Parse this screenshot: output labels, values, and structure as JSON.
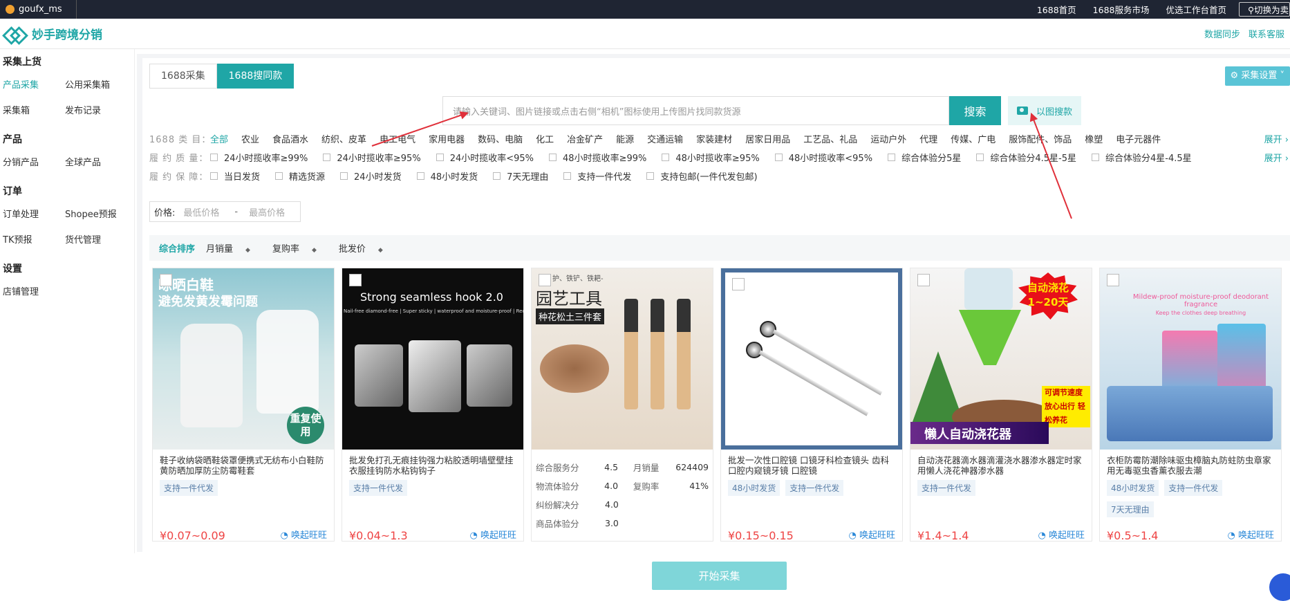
{
  "topbar": {
    "username": "goufx_ms",
    "links": [
      "1688首页",
      "1688服务市场",
      "优选工作台首页"
    ],
    "switch_label": "切换为卖家"
  },
  "header": {
    "brand": "妙手跨境分销",
    "right_links": [
      "数据同步",
      "联系客服"
    ]
  },
  "sidebar": {
    "groups": [
      {
        "title": "采集上货",
        "items": [
          "产品采集",
          "公用采集箱",
          "采集箱",
          "发布记录"
        ]
      },
      {
        "title": "产品",
        "items": [
          "分销产品",
          "全球产品"
        ]
      },
      {
        "title": "订单",
        "items": [
          "订单处理",
          "Shopee预报",
          "TK预报",
          "货代管理"
        ]
      },
      {
        "title": "设置",
        "items": [
          "店铺管理"
        ]
      }
    ],
    "active_item": "产品采集"
  },
  "tabs": [
    {
      "label": "1688采集",
      "active": false
    },
    {
      "label": "1688搜同款",
      "active": true
    }
  ],
  "collect_settings_label": "采集设置",
  "search": {
    "placeholder": "请输入关键词、图片链接或点击右侧“相机”图标使用上传图片找同款货源",
    "button_label": "搜索",
    "image_search_label": "以图搜款"
  },
  "filters": {
    "category": {
      "label": "1688 类 目：",
      "options": [
        "全部",
        "农业",
        "食品酒水",
        "纺织、皮革",
        "电工电气",
        "家用电器",
        "数码、电脑",
        "化工",
        "冶金矿产",
        "能源",
        "交通运输",
        "家装建材",
        "居家日用品",
        "工艺品、礼品",
        "运动户外",
        "代理",
        "传媒、广电",
        "服饰配件、饰品",
        "橡塑",
        "电子元器件"
      ],
      "expand": "展开"
    },
    "quality": {
      "label": "履 约 质 量：",
      "options": [
        "24小时揽收率≥99%",
        "24小时揽收率≥95%",
        "24小时揽收率<95%",
        "48小时揽收率≥99%",
        "48小时揽收率≥95%",
        "48小时揽收率<95%",
        "综合体验分5星",
        "综合体验分4.5星-5星",
        "综合体验分4星-4.5星"
      ],
      "expand": "展开"
    },
    "guarantee": {
      "label": "履 约 保 障：",
      "options": [
        "当日发货",
        "精选货源",
        "24小时发货",
        "48小时发货",
        "7天无理由",
        "支持一件代发",
        "支持包邮(一件代发包邮)"
      ]
    }
  },
  "price_filter": {
    "label": "价格:",
    "min_placeholder": "最低价格",
    "separator": "-",
    "max_placeholder": "最高价格"
  },
  "sort": [
    "综合排序",
    "月销量",
    "复购率",
    "批发价"
  ],
  "products": [
    {
      "name": "鞋子收纳袋晒鞋袋罩便携式无纺布小白鞋防黄防晒加厚防尘防霉鞋套",
      "tags": [
        "支持一件代发"
      ],
      "price": "¥0.07~0.09",
      "ww": "唤起旺旺",
      "img_title": "晾晒白鞋",
      "img_sub": "避免发黄发霉问题",
      "img_badge": "重复使用"
    },
    {
      "name": "批发免打孔无痕挂钩强力粘胶透明墙壁壁挂衣服挂钩防水粘钩钩子",
      "tags": [
        "支持一件代发"
      ],
      "price": "¥0.04~1.3",
      "ww": "唤起旺旺",
      "img_title": "Strong seamless hook 2.0",
      "img_sub": "Nail-free diamond-free | Super sticky | waterproof and moisture-proof | Recycling"
    },
    {
      "name": "",
      "tags": [],
      "price": "",
      "ww": "",
      "img_title": "园艺工具",
      "img_sub": "种花松土三件套",
      "img_top": "护、铁铲、铁耙-",
      "stats": [
        {
          "k": "综合服务分",
          "v": "4.5",
          "k2": "月销量",
          "v2": "624409"
        },
        {
          "k": "物流体验分",
          "v": "4.0",
          "k2": "复购率",
          "v2": "41%"
        },
        {
          "k": "纠纷解决分",
          "v": "4.0"
        },
        {
          "k": "商品体验分",
          "v": "3.0"
        }
      ]
    },
    {
      "name": "批发一次性口腔镜 口镜牙科检查镜头 齿科口腔内窥镜牙镜 口腔镜",
      "tags": [
        "48小时发货",
        "支持一件代发"
      ],
      "price": "¥0.15~0.15",
      "ww": "唤起旺旺"
    },
    {
      "name": "自动浇花器滴水器滴灌浇水器渗水器定时家用懒人浇花神器渗水器",
      "tags": [
        "支持一件代发"
      ],
      "price": "¥1.4~1.4",
      "ww": "唤起旺旺",
      "img_title": "懒人自动浇花器",
      "img_badge": "自动浇花 1~20天",
      "img_side": "可调节速度 放心出行 轻松养花"
    },
    {
      "name": "衣柜防霉防潮除味驱虫樟脑丸防蛀防虫章家用无毒驱虫香薰衣服去潮",
      "tags": [
        "48小时发货",
        "支持一件代发",
        "7天无理由"
      ],
      "price": "¥0.5~1.4",
      "ww": "唤起旺旺",
      "img_title": "Mildew-proof moisture-proof deodorant fragrance",
      "img_sub": "Keep the clothes deep breathing"
    }
  ],
  "start_button": "开始采集",
  "colors": {
    "accent": "#1fa6a6",
    "price": "#e44444",
    "arrow": "#e0303a"
  }
}
